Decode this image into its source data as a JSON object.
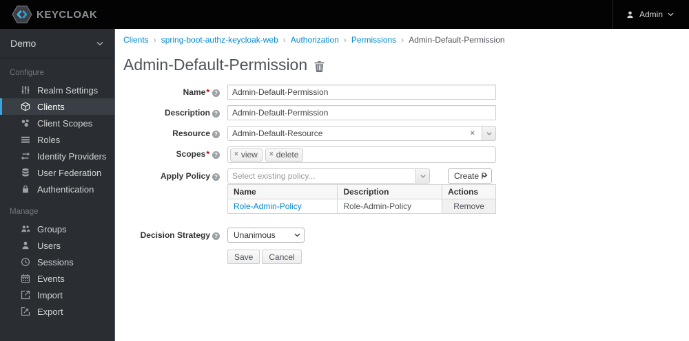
{
  "header": {
    "logo_text": "KEYCLOAK",
    "user_menu": {
      "label": "Admin"
    }
  },
  "sidebar": {
    "realm_selector": {
      "label": "Demo"
    },
    "sections": [
      {
        "label": "Configure",
        "items": [
          {
            "label": "Realm Settings",
            "icon": "sliders-icon",
            "active": false
          },
          {
            "label": "Clients",
            "icon": "cube-icon",
            "active": true
          },
          {
            "label": "Client Scopes",
            "icon": "scopes-icon",
            "active": false
          },
          {
            "label": "Roles",
            "icon": "list-icon",
            "active": false
          },
          {
            "label": "Identity Providers",
            "icon": "swap-arrows-icon",
            "active": false
          },
          {
            "label": "User Federation",
            "icon": "database-icon",
            "active": false
          },
          {
            "label": "Authentication",
            "icon": "lock-icon",
            "active": false
          }
        ]
      },
      {
        "label": "Manage",
        "items": [
          {
            "label": "Groups",
            "icon": "groups-icon",
            "active": false
          },
          {
            "label": "Users",
            "icon": "user-icon",
            "active": false
          },
          {
            "label": "Sessions",
            "icon": "clock-icon",
            "active": false
          },
          {
            "label": "Events",
            "icon": "calendar-icon",
            "active": false
          },
          {
            "label": "Import",
            "icon": "import-icon",
            "active": false
          },
          {
            "label": "Export",
            "icon": "export-icon",
            "active": false
          }
        ]
      }
    ]
  },
  "breadcrumb": {
    "separator": "›",
    "items": [
      "Clients",
      "spring-boot-authz-keycloak-web",
      "Authorization",
      "Permissions",
      "Admin-Default-Permission"
    ]
  },
  "page": {
    "title": "Admin-Default-Permission"
  },
  "markers": {
    "required": "*",
    "help": "?",
    "clear": "×"
  },
  "form": {
    "name": {
      "label": "Name",
      "value": "Admin-Default-Permission"
    },
    "description": {
      "label": "Description",
      "value": "Admin-Default-Permission"
    },
    "resource": {
      "label": "Resource",
      "value": "Admin-Default-Resource"
    },
    "scopes": {
      "label": "Scopes",
      "tags": [
        "view",
        "delete"
      ]
    },
    "apply_policy": {
      "label": "Apply Policy",
      "placeholder": "Select existing policy...",
      "create_button": "Create P",
      "table": {
        "headers": [
          "Name",
          "Description",
          "Actions"
        ],
        "rows": [
          {
            "name": "Role-Admin-Policy",
            "description": "Role-Admin-Policy",
            "action": "Remove"
          }
        ]
      }
    },
    "decision_strategy": {
      "label": "Decision Strategy",
      "value": "Unanimous"
    },
    "buttons": {
      "save": "Save",
      "cancel": "Cancel"
    }
  },
  "colors": {
    "accent_blue": "#0088ce",
    "nav_active_border": "#39a5dc",
    "sidebar_bg": "#2a2e33",
    "navbar_bg": "#030303",
    "required_red": "#c00000"
  }
}
